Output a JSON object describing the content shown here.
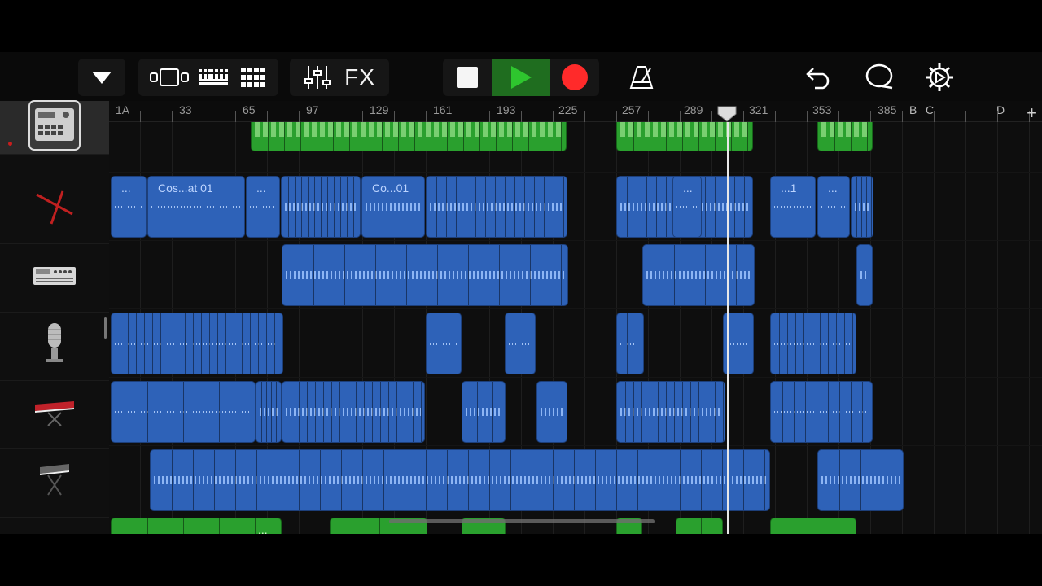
{
  "toolbar": {
    "fx_label": "FX",
    "icons": [
      "browser-dropdown-icon",
      "track-view-icon",
      "tracks-grid-view-icon",
      "live-loops-icon",
      "mixer-icon",
      "stop-icon",
      "play-icon",
      "record-icon",
      "metronome-icon",
      "undo-icon",
      "loop-browser-icon",
      "settings-icon"
    ],
    "colors": {
      "play": "#2ec62e",
      "record": "#ff2a2a",
      "play_bg": "#1f6d1f"
    }
  },
  "ruler": {
    "bars": [
      "1A",
      "33",
      "65",
      "97",
      "129",
      "161",
      "193",
      "225",
      "257",
      "289",
      "321",
      "353",
      "385"
    ],
    "sections": [
      "B",
      "C",
      "D"
    ],
    "add_label": "+"
  },
  "tracks": [
    {
      "instrument": "drum-machine-icon",
      "selected": true
    },
    {
      "instrument": "drum-sticks-icon"
    },
    {
      "instrument": "synth-module-icon"
    },
    {
      "instrument": "microphone-icon"
    },
    {
      "instrument": "red-keyboard-icon"
    },
    {
      "instrument": "grey-keyboard-icon"
    },
    {
      "instrument": "red-keyboard-icon"
    }
  ],
  "regions": {
    "track2_labels": [
      "...",
      "Cos...at 01",
      "...",
      "Co...01",
      "...",
      "...1",
      "..."
    ],
    "track7_labels": [
      "...",
      "...",
      "..."
    ],
    "track1_labels": [
      ":"
    ]
  },
  "colors": {
    "audio": "#2e62b8",
    "midi": "#2aa02e"
  }
}
